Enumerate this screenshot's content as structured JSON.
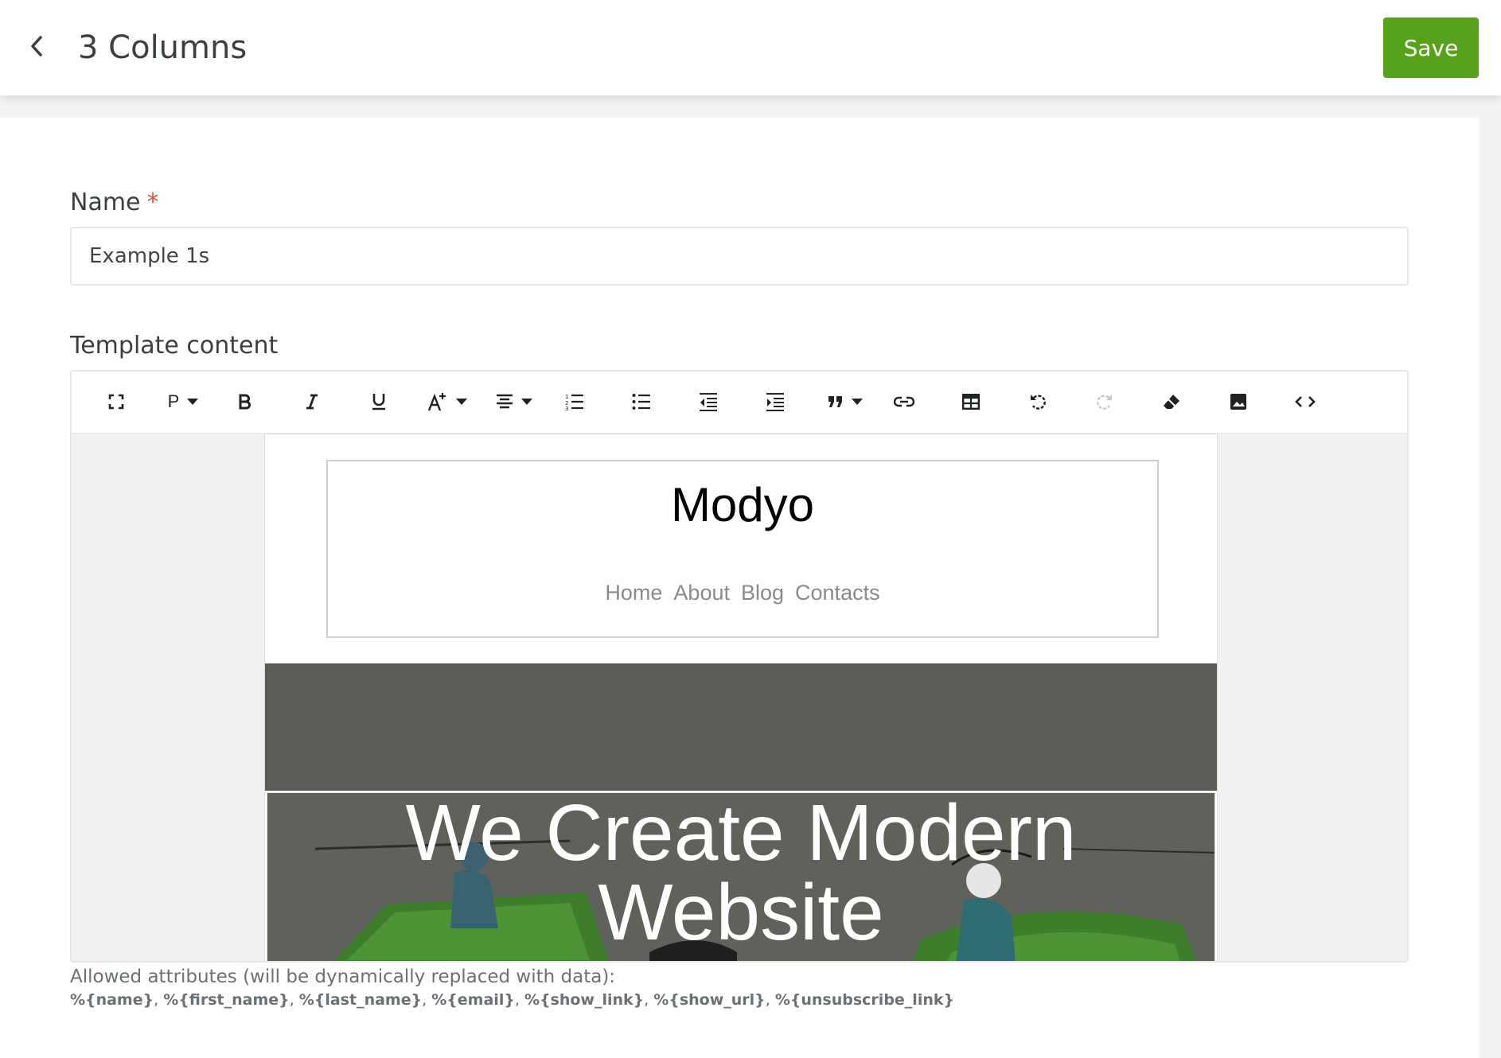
{
  "header": {
    "title": "3 Columns",
    "save_label": "Save"
  },
  "form": {
    "name_label": "Name",
    "required_mark": "*",
    "name_value": "Example 1s",
    "template_label": "Template content"
  },
  "toolbar": {
    "paragraph_label": "P",
    "items": [
      "fullscreen-icon",
      "paragraph-style",
      "bold-icon",
      "italic-icon",
      "underline-icon",
      "font-size-icon",
      "align-icon",
      "ordered-list-icon",
      "unordered-list-icon",
      "outdent-icon",
      "indent-icon",
      "quote-icon",
      "link-icon",
      "table-icon",
      "undo-icon",
      "redo-icon",
      "clear-format-icon",
      "image-icon",
      "code-view-icon"
    ]
  },
  "preview": {
    "brand": "Modyo",
    "nav": [
      "Home",
      "About",
      "Blog",
      "Contacts"
    ],
    "hero_line1": "We Create Modern",
    "hero_line2": "Website"
  },
  "footer": {
    "hint": "Allowed attributes (will be dynamically replaced with data):",
    "attributes": [
      "%{name}",
      "%{first_name}",
      "%{last_name}",
      "%{email}",
      "%{show_link}",
      "%{show_url}",
      "%{unsubscribe_link}"
    ],
    "separator": ", "
  },
  "colors": {
    "save": "#58a11a",
    "required": "#d9534f",
    "hero_bg": "#5a5d57"
  }
}
